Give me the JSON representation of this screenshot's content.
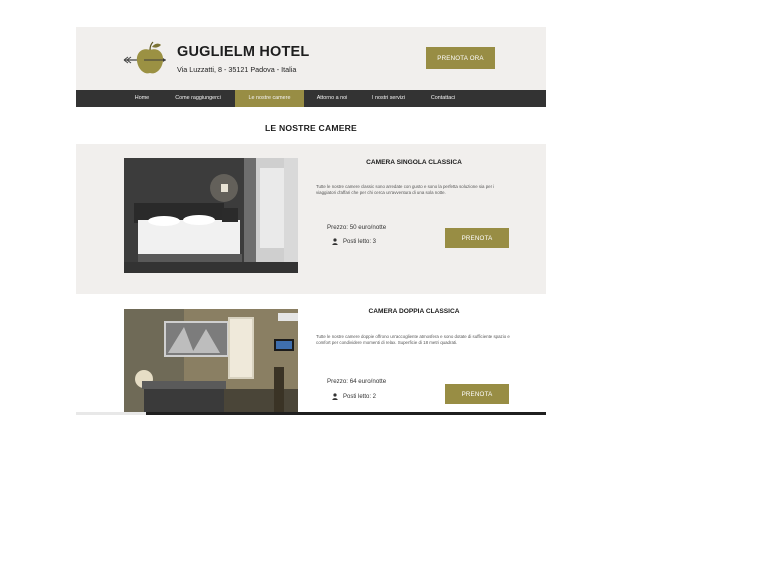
{
  "header": {
    "title": "GUGLIELM HOTEL",
    "address": "Via Luzzatti, 8 - 35121 Padova - Italia",
    "cta_label": "PRENOTA ORA",
    "logo_icon": "apple-with-arrow-icon"
  },
  "nav": {
    "items": [
      {
        "label": "Home",
        "active": false
      },
      {
        "label": "Come raggiungerci",
        "active": false
      },
      {
        "label": "Le nostre camere",
        "active": true
      },
      {
        "label": "Attorno a noi",
        "active": false
      },
      {
        "label": "I nostri servizi",
        "active": false
      },
      {
        "label": "Contattaci",
        "active": false
      }
    ]
  },
  "section": {
    "title": "LE NOSTRE CAMERE"
  },
  "rooms": [
    {
      "name": "CAMERA SINGOLA CLASSICA",
      "description": "Tutte le nostre camere classic sono arredate con gusto e sono la perfetta soluzione sia per i viaggiatori d'affari che per chi cerca un'avventura di una sola notte.",
      "price": "Prezzo: 50 euro/notte",
      "beds": "Posti letto: 3",
      "book_label": "PRENOTA"
    },
    {
      "name": "CAMERA DOPPIA CLASSICA",
      "description": "Tutte le nostre camere doppie offrono un'accogliente atmosfera e sono dotate di sufficiente spazio e comfort per condividere momenti di relax. Superficie di 18 metri quadrati.",
      "price": "Prezzo: 64 euro/notte",
      "beds": "Posti letto: 2",
      "book_label": "PRENOTA"
    }
  ],
  "colors": {
    "accent": "#988d44",
    "nav_bg": "#333333",
    "header_bg": "#f1efed"
  }
}
